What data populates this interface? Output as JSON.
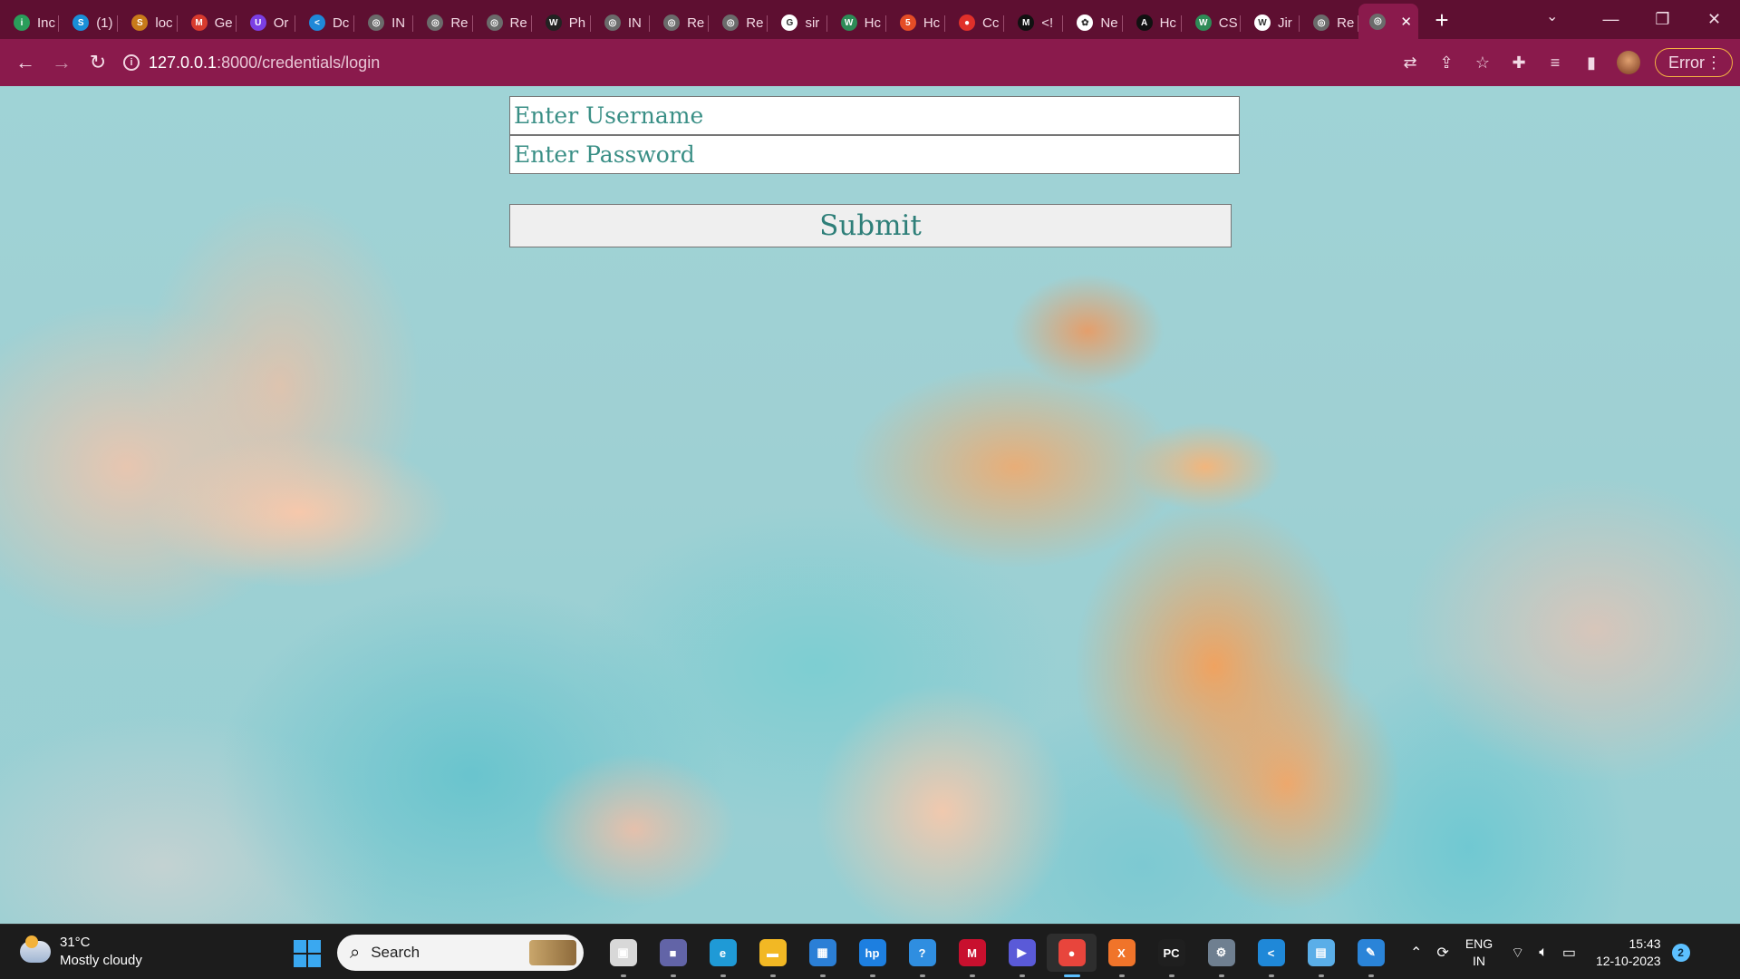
{
  "browser": {
    "tabs": [
      {
        "label": "Inc",
        "icon": "indeed-icon",
        "color": "#2a9d5a",
        "glyph": "i"
      },
      {
        "label": "(1)",
        "icon": "skype-icon",
        "color": "#1a8fd8",
        "glyph": "S"
      },
      {
        "label": "loc",
        "icon": "sonar-icon",
        "color": "#c87a1a",
        "glyph": "S"
      },
      {
        "label": "Ge",
        "icon": "gmail-icon",
        "color": "#d83b2e",
        "glyph": "M"
      },
      {
        "label": "Or",
        "icon": "unstop-icon",
        "color": "#7b3fe4",
        "glyph": "U"
      },
      {
        "label": "Dc",
        "icon": "vscode-icon",
        "color": "#1f88d8",
        "glyph": "<"
      },
      {
        "label": "IN",
        "icon": "globe-icon",
        "color": "#6b6b6b",
        "glyph": "◎"
      },
      {
        "label": "Re",
        "icon": "globe-icon",
        "color": "#6b6b6b",
        "glyph": "◎"
      },
      {
        "label": "Re",
        "icon": "globe-icon",
        "color": "#6b6b6b",
        "glyph": "◎"
      },
      {
        "label": "Ph",
        "icon": "wr-icon",
        "color": "#222222",
        "glyph": "W"
      },
      {
        "label": "IN",
        "icon": "globe-icon",
        "color": "#6b6b6b",
        "glyph": "◎"
      },
      {
        "label": "Re",
        "icon": "globe-icon",
        "color": "#6b6b6b",
        "glyph": "◎"
      },
      {
        "label": "Re",
        "icon": "globe-icon",
        "color": "#6b6b6b",
        "glyph": "◎"
      },
      {
        "label": "sir",
        "icon": "google-icon",
        "color": "#ffffff",
        "glyph": "G"
      },
      {
        "label": "Hc",
        "icon": "w3-icon",
        "color": "#2e8b57",
        "glyph": "W"
      },
      {
        "label": "Hc",
        "icon": "html-icon",
        "color": "#e44d26",
        "glyph": "5"
      },
      {
        "label": "Cc",
        "icon": "record-icon",
        "color": "#e0302a",
        "glyph": "●"
      },
      {
        "label": "<!",
        "icon": "m-icon",
        "color": "#111111",
        "glyph": "M"
      },
      {
        "label": "Ne",
        "icon": "chatgpt-icon",
        "color": "#ffffff",
        "glyph": "✿"
      },
      {
        "label": "Hc",
        "icon": "a-icon",
        "color": "#111111",
        "glyph": "A"
      },
      {
        "label": "CS",
        "icon": "w3-icon",
        "color": "#2e8b57",
        "glyph": "W"
      },
      {
        "label": "Jir",
        "icon": "jira-icon",
        "color": "#ffffff",
        "glyph": "W"
      },
      {
        "label": "Re",
        "icon": "globe-icon",
        "color": "#6b6b6b",
        "glyph": "◎"
      }
    ],
    "active_tab": {
      "icon": "globe-icon",
      "close": "✕"
    },
    "new_tab": "+",
    "url_host": "127.0.0.1",
    "url_path": ":8000/credentials/login",
    "error_label": "Error",
    "accent": "#8a1a4c"
  },
  "login": {
    "username_placeholder": "Enter Username",
    "password_placeholder": "Enter Password",
    "submit_label": "Submit",
    "text_color": "#3a8f86"
  },
  "taskbar": {
    "weather_temp": "31°C",
    "weather_desc": "Mostly cloudy",
    "search_placeholder": "Search",
    "apps": [
      {
        "name": "task-view-icon",
        "color": "#d8d8d8",
        "glyph": "▣"
      },
      {
        "name": "teams-icon",
        "color": "#6264a7",
        "glyph": "■"
      },
      {
        "name": "edge-icon",
        "color": "#1f9ad6",
        "glyph": "e"
      },
      {
        "name": "file-explorer-icon",
        "color": "#f2b824",
        "glyph": "▬"
      },
      {
        "name": "store-icon",
        "color": "#2b7fd6",
        "glyph": "▦"
      },
      {
        "name": "myhp-icon",
        "color": "#1d7fe0",
        "glyph": "hp"
      },
      {
        "name": "help-icon",
        "color": "#2f8ee0",
        "glyph": "?"
      },
      {
        "name": "mcafee-icon",
        "color": "#c8102e",
        "glyph": "M"
      },
      {
        "name": "copilot-icon",
        "color": "#5a5ad8",
        "glyph": "▶"
      },
      {
        "name": "chrome-icon",
        "color": "#e8453c",
        "glyph": "●"
      },
      {
        "name": "xampp-icon",
        "color": "#f0742a",
        "glyph": "X"
      },
      {
        "name": "pycharm-icon",
        "color": "#1f1f1f",
        "glyph": "PC"
      },
      {
        "name": "settings-icon",
        "color": "#6f7f90",
        "glyph": "⚙"
      },
      {
        "name": "vscode-icon",
        "color": "#1f88d8",
        "glyph": "<"
      },
      {
        "name": "network-app-icon",
        "color": "#5aaee8",
        "glyph": "▤"
      },
      {
        "name": "paint-icon",
        "color": "#2a84d8",
        "glyph": "✎"
      }
    ],
    "active_app": "chrome-icon",
    "lang_line1": "ENG",
    "lang_line2": "IN",
    "time": "15:43",
    "date": "12-10-2023",
    "notification_count": "2"
  }
}
